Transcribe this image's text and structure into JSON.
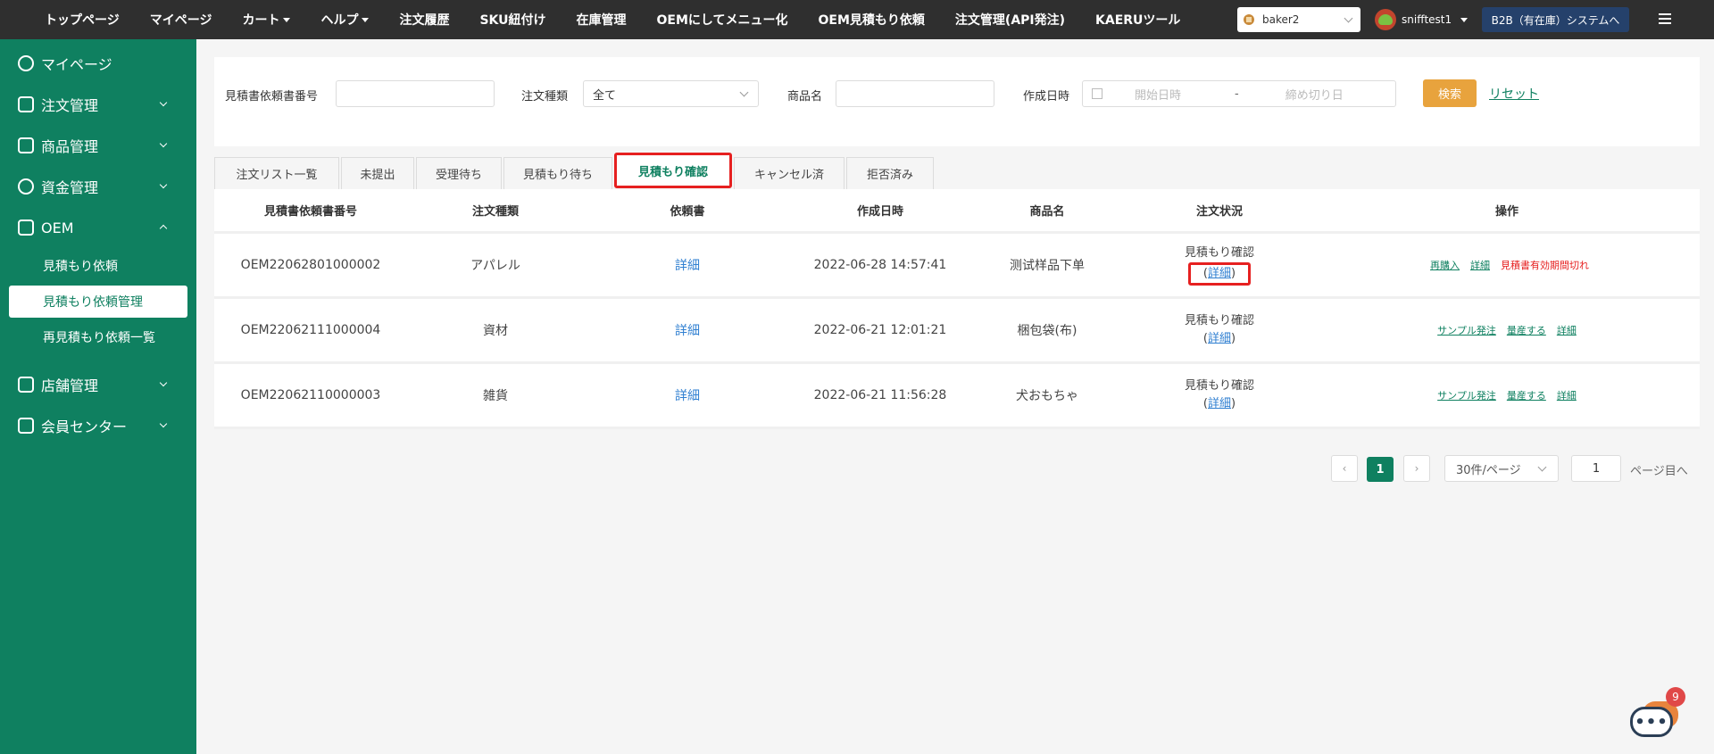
{
  "topnav": [
    "トップページ",
    "マイページ",
    "カート",
    "ヘルプ",
    "注文履歴",
    "SKU紐付け",
    "在庫管理",
    "OEMにしてメニュー化",
    "OEM見積もり依頼",
    "注文管理(API発注)",
    "KAERUツール"
  ],
  "shop": "baker2",
  "user": "snifftest1",
  "system_label": "B2B（有在庫）システムへ",
  "sidebar": {
    "mypage": "マイページ",
    "orders": "注文管理",
    "products": "商品管理",
    "funds": "資金管理",
    "oem": "OEM",
    "oem_sub": [
      "見積もり依頼",
      "見積もり依頼管理",
      "再見積もり依頼一覧"
    ],
    "stores": "店舗管理",
    "members": "会員センター"
  },
  "filter": {
    "quote_no_label": "見積書依頼書番号",
    "quote_no_value": "",
    "order_type_label": "注文種類",
    "order_type_value": "全て",
    "product_label": "商品名",
    "product_value": "",
    "date_label": "作成日時",
    "date_start_placeholder": "開始日時",
    "date_sep": "-",
    "date_end_placeholder": "締め切り日",
    "search": "検索",
    "reset": "リセット"
  },
  "tabs": [
    "注文リスト一覧",
    "未提出",
    "受理待ち",
    "見積もり待ち",
    "見積もり確認",
    "キャンセル済",
    "拒否済み"
  ],
  "active_tab": "見積もり確認",
  "table": {
    "headers": [
      "見積書依頼書番号",
      "注文種類",
      "依頼書",
      "作成日時",
      "商品名",
      "注文状況",
      "操作"
    ],
    "rows": [
      {
        "no": "OEM22062801000002",
        "type": "アパレル",
        "doc": "詳細",
        "date": "2022-06-28 14:57:41",
        "name": "测试样品下单",
        "status": "見積もり確認",
        "status_link": "詳細",
        "op1": "再購入",
        "op2": "詳細",
        "op3": "見積書有効期間切れ"
      },
      {
        "no": "OEM22062111000004",
        "type": "資材",
        "doc": "詳細",
        "date": "2022-06-21 12:01:21",
        "name": "梱包袋(布)",
        "status": "見積もり確認",
        "status_link": "詳細",
        "op1": "サンプル発注",
        "op2": "量産する",
        "op3": "詳細"
      },
      {
        "no": "OEM22062110000003",
        "type": "雑貨",
        "doc": "詳細",
        "date": "2022-06-21 11:56:28",
        "name": "犬おもちゃ",
        "status": "見積もり確認",
        "status_link": "詳細",
        "op1": "サンプル発注",
        "op2": "量産する",
        "op3": "詳細"
      }
    ]
  },
  "pager": {
    "prev": "‹",
    "current": "1",
    "next": "›",
    "page_size": "30件/ページ",
    "goto_value": "1",
    "goto_label": "ページ目へ"
  },
  "chat": {
    "badge": "9",
    "glyph": "•••"
  }
}
